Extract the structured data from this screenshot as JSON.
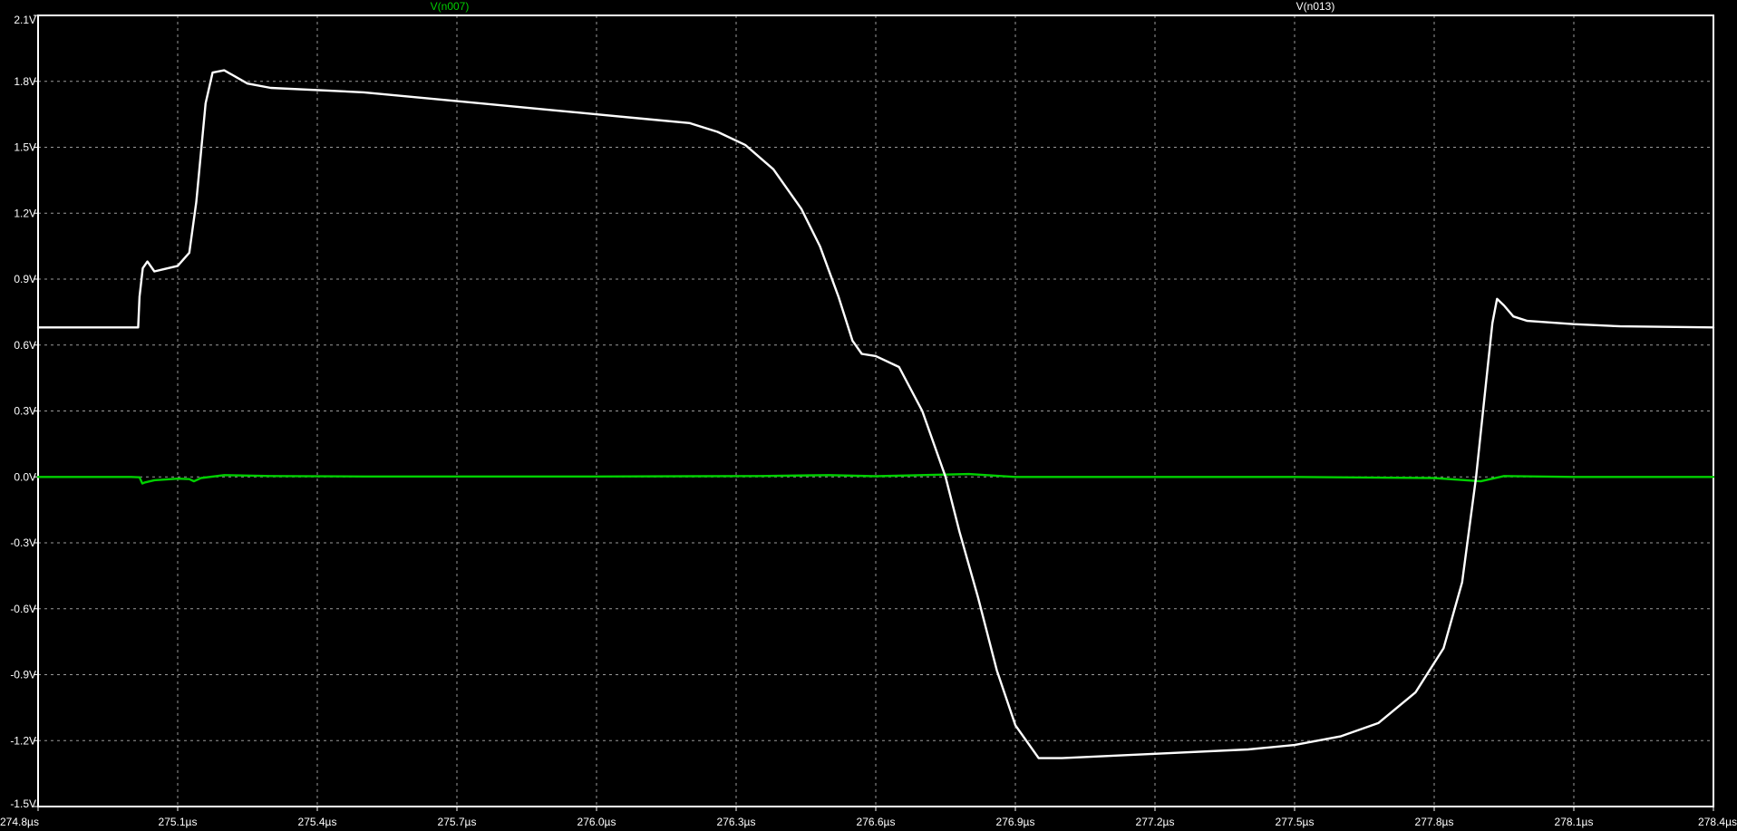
{
  "chart_data": {
    "type": "line",
    "title": "",
    "xlabel": "",
    "ylabel": "",
    "xlim": [
      274.8,
      278.4
    ],
    "ylim": [
      -1.5,
      2.1
    ],
    "grid": true,
    "legend": "top",
    "background_color": "#000000",
    "grid_color": "#9a9a9a",
    "axis_color": "#ffffff",
    "x_ticks": [
      274.8,
      275.1,
      275.4,
      275.7,
      276.0,
      276.3,
      276.6,
      276.9,
      277.2,
      277.5,
      277.8,
      278.1,
      278.4
    ],
    "x_tick_labels": [
      "274.8µs",
      "275.1µs",
      "275.4µs",
      "275.7µs",
      "276.0µs",
      "276.3µs",
      "276.6µs",
      "276.9µs",
      "277.2µs",
      "277.5µs",
      "277.8µs",
      "278.1µs",
      "278.4µs"
    ],
    "y_ticks": [
      2.1,
      1.8,
      1.5,
      1.2,
      0.9,
      0.6,
      0.3,
      0.0,
      -0.3,
      -0.6,
      -0.9,
      -1.2,
      -1.5
    ],
    "y_tick_labels": [
      "2.1V",
      "1.8V",
      "1.5V",
      "1.2V",
      "0.9V",
      "0.6V",
      "0.3V",
      "0.0V",
      "-0.3V",
      "-0.6V",
      "-0.9V",
      "-1.2V",
      "-1.5V"
    ],
    "series": [
      {
        "name": "V(n007)",
        "color": "#00d000",
        "x": [
          274.8,
          275.0,
          275.018,
          275.024,
          275.03,
          275.05,
          275.1,
          275.125,
          275.135,
          275.15,
          275.2,
          275.3,
          275.5,
          276.0,
          276.35,
          276.5,
          276.6,
          276.8,
          276.9,
          277.5,
          277.8,
          277.9,
          277.95,
          278.1,
          278.4
        ],
        "y": [
          0.0,
          0.0,
          -0.002,
          -0.03,
          -0.025,
          -0.015,
          -0.008,
          -0.01,
          -0.02,
          -0.005,
          0.008,
          0.004,
          0.002,
          0.002,
          0.004,
          0.008,
          0.003,
          0.013,
          0.0,
          0.0,
          -0.005,
          -0.02,
          0.004,
          0.0,
          0.0
        ]
      },
      {
        "name": "V(n013)",
        "color": "#ffffff",
        "x": [
          274.8,
          275.015,
          275.018,
          275.025,
          275.035,
          275.05,
          275.07,
          275.1,
          275.125,
          275.14,
          275.16,
          275.175,
          275.2,
          275.25,
          275.3,
          275.5,
          275.7,
          275.9,
          276.1,
          276.2,
          276.26,
          276.32,
          276.38,
          276.44,
          276.48,
          276.52,
          276.55,
          276.57,
          276.6,
          276.65,
          276.7,
          276.75,
          276.78,
          276.82,
          276.86,
          276.9,
          276.95,
          277.0,
          277.2,
          277.4,
          277.5,
          277.6,
          277.68,
          277.76,
          277.82,
          277.86,
          277.89,
          277.915,
          277.925,
          277.935,
          277.95,
          277.97,
          278.0,
          278.1,
          278.2,
          278.4
        ],
        "y": [
          0.68,
          0.68,
          0.82,
          0.95,
          0.98,
          0.935,
          0.945,
          0.96,
          1.02,
          1.25,
          1.7,
          1.84,
          1.85,
          1.79,
          1.77,
          1.75,
          1.71,
          1.67,
          1.63,
          1.61,
          1.57,
          1.51,
          1.4,
          1.22,
          1.05,
          0.82,
          0.62,
          0.56,
          0.55,
          0.5,
          0.3,
          0.0,
          -0.25,
          -0.55,
          -0.88,
          -1.13,
          -1.28,
          -1.28,
          -1.26,
          -1.24,
          -1.22,
          -1.18,
          -1.12,
          -0.98,
          -0.78,
          -0.48,
          0.0,
          0.5,
          0.7,
          0.81,
          0.78,
          0.73,
          0.71,
          0.695,
          0.685,
          0.68
        ]
      }
    ]
  }
}
